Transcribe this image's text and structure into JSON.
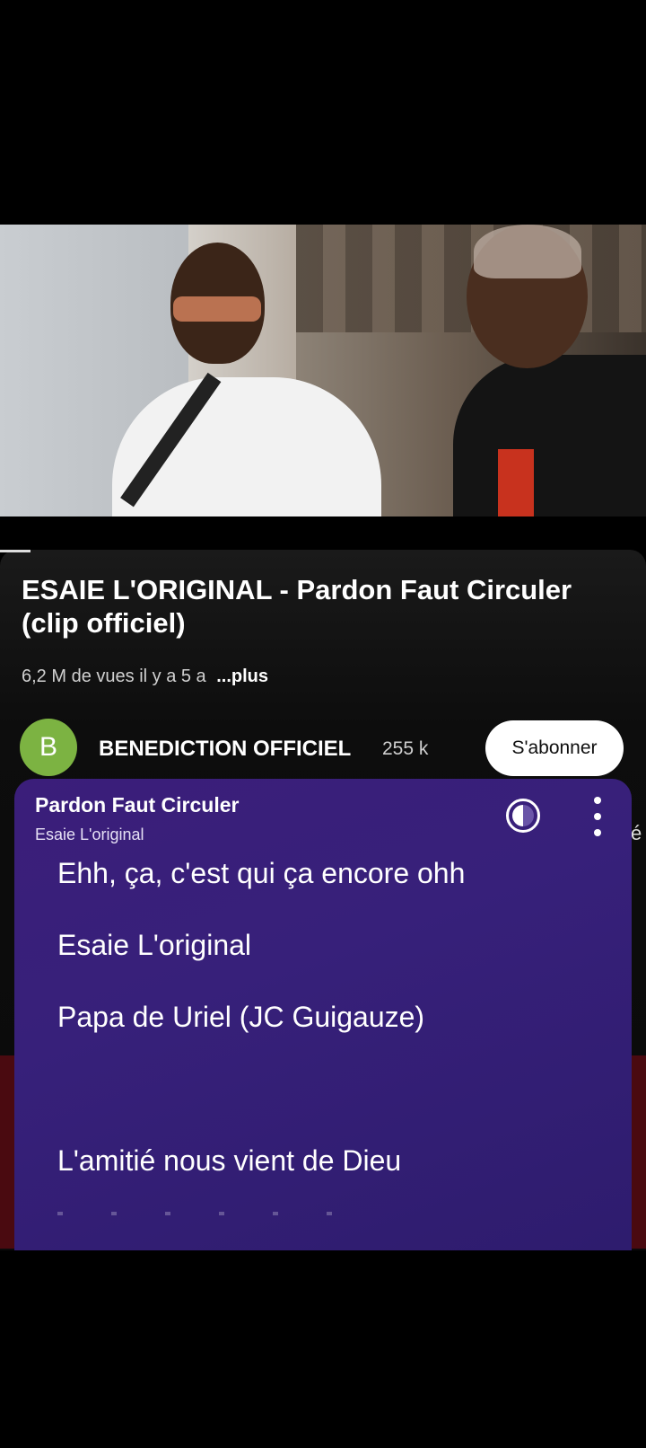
{
  "video": {},
  "details": {
    "title": "ESAIE L'ORIGINAL - Pardon Faut Circuler (clip officiel)",
    "views": "6,2 M de vues",
    "age": "il y a 5 a",
    "more_label": "...plus"
  },
  "channel": {
    "avatar_letter": "B",
    "name": "BENEDICTION OFFICIEL",
    "subscribers": "255 k",
    "subscribe_label": "S'abonner",
    "peek_text": "é"
  },
  "lyrics_card": {
    "song_title": "Pardon Faut Circuler",
    "artist": "Esaie L'original",
    "lines": [
      "Ehh, ça, c'est qui ça encore ohh",
      "Esaie L'original",
      "Papa de Uriel (JC Guigauze)",
      "L'amitié nous vient de Dieu"
    ],
    "accent_color": "#3b1e7a"
  }
}
